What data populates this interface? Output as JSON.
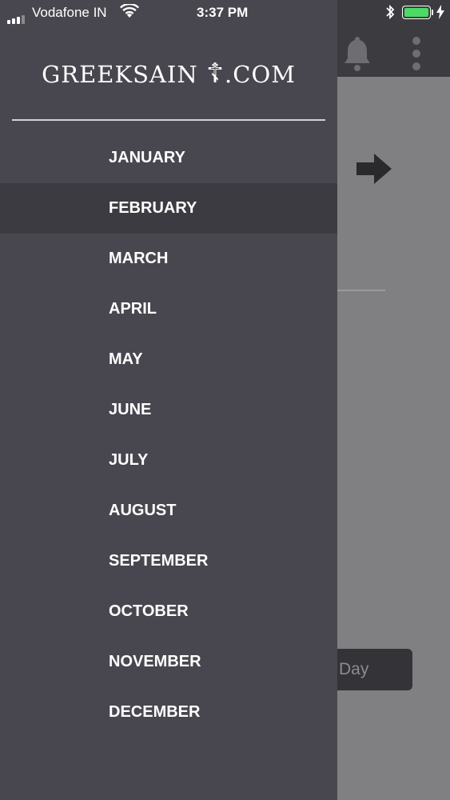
{
  "status_bar": {
    "carrier": "Vodafone IN",
    "time": "3:37 PM",
    "battery_color": "#4cd964"
  },
  "drawer": {
    "logo": {
      "text_left": "GREEKSAIN",
      "cross": "☦",
      "text_right": ".COM"
    },
    "months": [
      {
        "label": "JANUARY",
        "active": false
      },
      {
        "label": "FEBRUARY",
        "active": true
      },
      {
        "label": "MARCH",
        "active": false
      },
      {
        "label": "APRIL",
        "active": false
      },
      {
        "label": "MAY",
        "active": false
      },
      {
        "label": "JUNE",
        "active": false
      },
      {
        "label": "JULY",
        "active": false
      },
      {
        "label": "AUGUST",
        "active": false
      },
      {
        "label": "SEPTEMBER",
        "active": false
      },
      {
        "label": "OCTOBER",
        "active": false
      },
      {
        "label": "NOVEMBER",
        "active": false
      },
      {
        "label": "DECEMBER",
        "active": false
      }
    ],
    "background_color": "#48474f",
    "active_color": "#3c3b42"
  },
  "background_app": {
    "header_icons": [
      "bell-icon",
      "more-vertical-icon"
    ],
    "next_icon": "arrow-right-icon",
    "day_button_label": "Day"
  }
}
